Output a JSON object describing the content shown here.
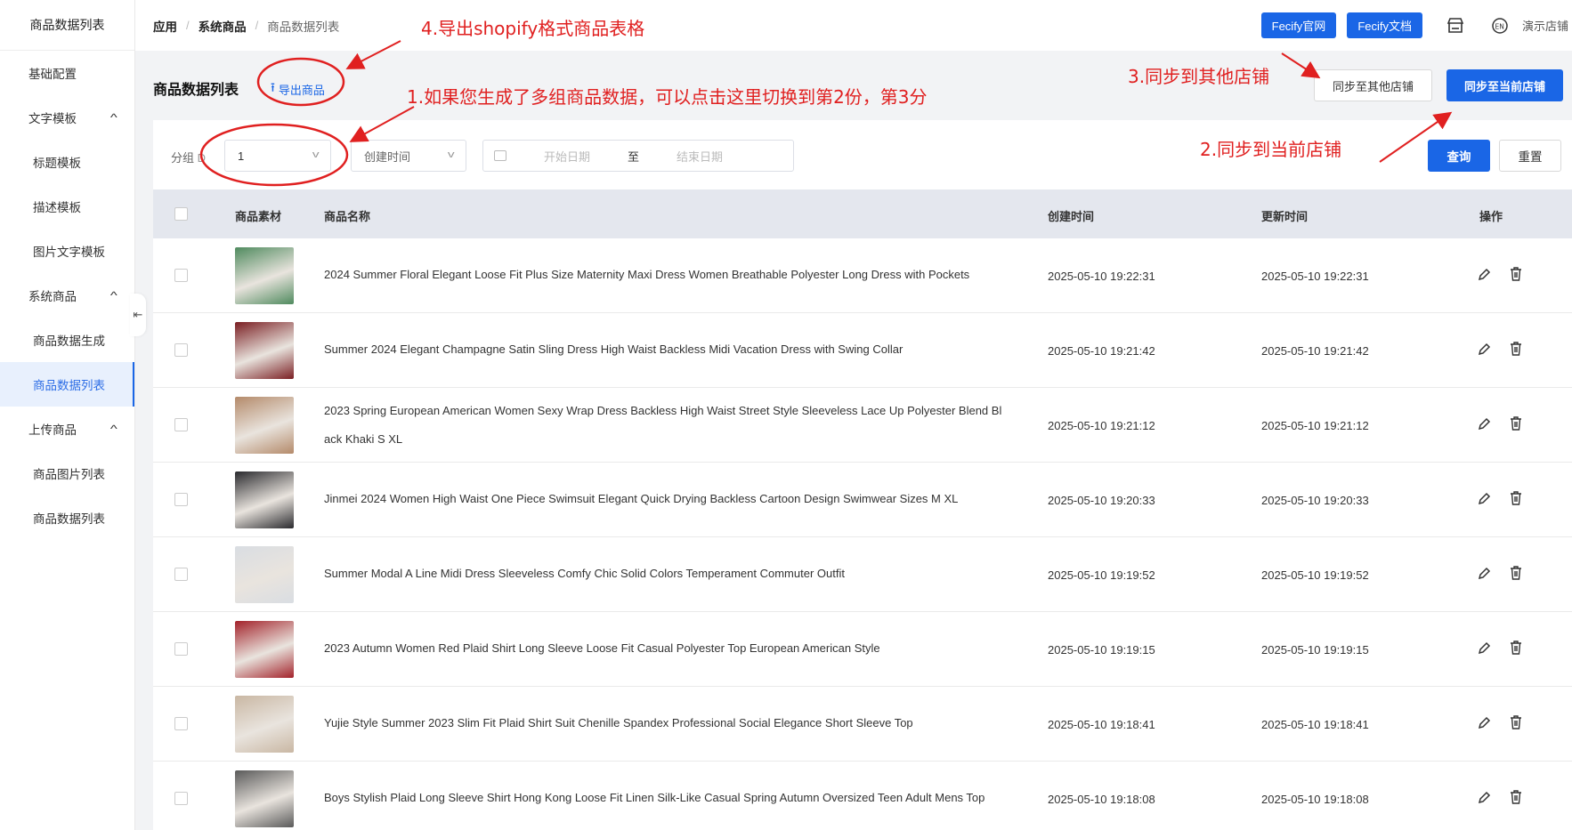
{
  "sidebar": {
    "brand": "商品数据列表",
    "items": [
      {
        "label": "基础配置",
        "type": "item"
      },
      {
        "label": "文字模板",
        "type": "group"
      },
      {
        "label": "标题模板",
        "type": "sub"
      },
      {
        "label": "描述模板",
        "type": "sub"
      },
      {
        "label": "图片文字模板",
        "type": "sub"
      },
      {
        "label": "系统商品",
        "type": "group"
      },
      {
        "label": "商品数据生成",
        "type": "sub"
      },
      {
        "label": "商品数据列表",
        "type": "sub",
        "active": true
      },
      {
        "label": "上传商品",
        "type": "group"
      },
      {
        "label": "商品图片列表",
        "type": "sub"
      },
      {
        "label": "商品数据列表",
        "type": "sub"
      }
    ]
  },
  "breadcrumb": [
    "应用",
    "系统商品",
    "商品数据列表"
  ],
  "topbar": {
    "site_button": "Fecify官网",
    "docs_button": "Fecify文档",
    "store_name": "演示店铺",
    "icons": [
      "store-icon",
      "language-icon"
    ]
  },
  "header": {
    "title": "商品数据列表",
    "export_label": "导出商品",
    "sync_other_label": "同步至其他店铺",
    "sync_current_label": "同步至当前店铺"
  },
  "filters": {
    "group_label": "分组",
    "group_label_suffix": "D",
    "group_value": "1",
    "sort_value": "创建时间",
    "start_placeholder": "开始日期",
    "range_sep": "至",
    "end_placeholder": "结束日期",
    "query_label": "查询",
    "reset_label": "重置"
  },
  "table": {
    "columns": [
      "商品素材",
      "商品名称",
      "创建时间",
      "更新时间",
      "操作"
    ],
    "rows": [
      {
        "name": "2024 Summer Floral Elegant Loose Fit Plus Size Maternity Maxi Dress Women Breathable Polyester Long Dress with Pockets",
        "created": "2025-05-10 19:22:31",
        "updated": "2025-05-10 19:22:31",
        "thumb": "#4f8a5e"
      },
      {
        "name": "Summer 2024 Elegant Champagne Satin Sling Dress High Waist Backless Midi Vacation Dress with Swing Collar",
        "created": "2025-05-10 19:21:42",
        "updated": "2025-05-10 19:21:42",
        "thumb": "#7a1e22"
      },
      {
        "name": "2023 Spring European American Women Sexy Wrap Dress Backless High Waist Street Style Sleeveless Lace Up Polyester Blend Bl",
        "name2": "ack Khaki S XL",
        "created": "2025-05-10 19:21:12",
        "updated": "2025-05-10 19:21:12",
        "thumb": "#b48a6a"
      },
      {
        "name": "Jinmei 2024 Women High Waist One Piece Swimsuit Elegant Quick Drying Backless Cartoon Design Swimwear Sizes M XL",
        "created": "2025-05-10 19:20:33",
        "updated": "2025-05-10 19:20:33",
        "thumb": "#2a2a2e"
      },
      {
        "name": "Summer Modal A Line Midi Dress Sleeveless Comfy Chic Solid Colors Temperament Commuter Outfit",
        "created": "2025-05-10 19:19:52",
        "updated": "2025-05-10 19:19:52",
        "thumb": "#d9dde2"
      },
      {
        "name": "2023 Autumn Women Red Plaid Shirt Long Sleeve Loose Fit Casual Polyester Top European American Style",
        "created": "2025-05-10 19:19:15",
        "updated": "2025-05-10 19:19:15",
        "thumb": "#a3222a"
      },
      {
        "name": "Yujie Style Summer 2023 Slim Fit Plaid Shirt Suit Chenille Spandex Professional Social Elegance Short Sleeve Top",
        "created": "2025-05-10 19:18:41",
        "updated": "2025-05-10 19:18:41",
        "thumb": "#c9b7a3"
      },
      {
        "name": "Boys Stylish Plaid Long Sleeve Shirt Hong Kong Loose Fit Linen Silk-Like Casual Spring Autumn Oversized Teen Adult Mens Top",
        "created": "2025-05-10 19:18:08",
        "updated": "2025-05-10 19:18:08",
        "thumb": "#5a5a5a"
      }
    ]
  },
  "annotations": {
    "a1": "1.如果您生成了多组商品数据，可以点击这里切换到第2份，第3分",
    "a2": "2.同步到当前店铺",
    "a3": "3.同步到其他店铺",
    "a4": "4.导出shopify格式商品表格"
  },
  "colors": {
    "primary": "#1a66e6",
    "annotation": "#e02020"
  }
}
